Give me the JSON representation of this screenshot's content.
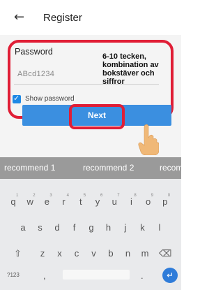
{
  "header": {
    "back_icon": "←",
    "title": "Register"
  },
  "form": {
    "password_label": "Password",
    "password_value": "ABcd1234",
    "show_password_label": "Show password",
    "show_password_checked": true
  },
  "annotation": {
    "tip_text": "6-10 tecken, kombination av bokstäver och siffror"
  },
  "next_button": {
    "label": "Next"
  },
  "suggestions": [
    "recommend 1",
    "recommend 2",
    "recom"
  ],
  "keyboard": {
    "row1": [
      {
        "k": "q",
        "n": "1"
      },
      {
        "k": "w",
        "n": "2"
      },
      {
        "k": "e",
        "n": "3"
      },
      {
        "k": "r",
        "n": "4"
      },
      {
        "k": "t",
        "n": "5"
      },
      {
        "k": "y",
        "n": "6"
      },
      {
        "k": "u",
        "n": "7"
      },
      {
        "k": "i",
        "n": "8"
      },
      {
        "k": "o",
        "n": "9"
      },
      {
        "k": "p",
        "n": "0"
      }
    ],
    "row2": [
      "a",
      "s",
      "d",
      "f",
      "g",
      "h",
      "j",
      "k",
      "l"
    ],
    "row3": [
      "z",
      "x",
      "c",
      "v",
      "b",
      "n",
      "m"
    ],
    "shift_icon": "⇧",
    "delete_icon": "⌫",
    "symbols_label": "?123",
    "comma_label": ",",
    "period_label": ".",
    "enter_icon": "↵"
  }
}
